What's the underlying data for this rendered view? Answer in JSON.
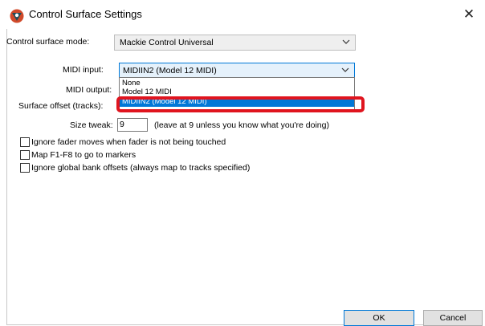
{
  "window": {
    "title": "Control Surface Settings",
    "close_glyph": "✕"
  },
  "mode": {
    "label": "Control surface mode:",
    "value": "Mackie Control Universal"
  },
  "midi_input": {
    "label": "MIDI input:",
    "value": "MIDIIN2 (Model 12 MIDI)",
    "options": [
      "None",
      "Model 12 MIDI",
      "MIDIIN2 (Model 12 MIDI)"
    ],
    "selected_index": 2
  },
  "midi_output": {
    "label": "MIDI output:"
  },
  "surface_offset": {
    "label": "Surface offset (tracks):"
  },
  "size_tweak": {
    "label": "Size tweak:",
    "value": "9",
    "hint": "(leave at 9 unless you know what you're doing)"
  },
  "options": [
    {
      "label": "Ignore fader moves when fader is not being touched",
      "checked": false
    },
    {
      "label": "Map F1-F8 to go to markers",
      "checked": false
    },
    {
      "label": "Ignore global bank offsets (always map to tracks specified)",
      "checked": false
    }
  ],
  "buttons": {
    "ok": "OK",
    "cancel": "Cancel"
  },
  "colors": {
    "selection": "#0078d7",
    "highlight_ring": "#e0141e",
    "app_icon": "#d04a2a"
  },
  "icons": {
    "app": "reaper-logo-icon",
    "close": "close-icon",
    "chevron": "chevron-down-icon"
  }
}
